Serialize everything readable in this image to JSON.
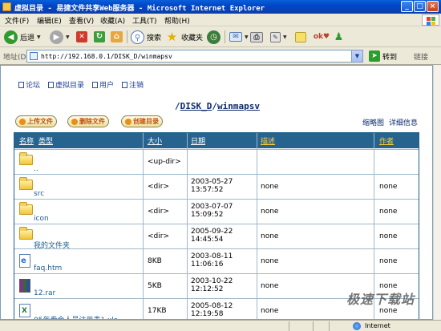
{
  "window": {
    "title": "虚拟目录 - 易捷文件共享Web服务器 - Microsoft Internet Explorer",
    "minimize": "_",
    "maximize": "□",
    "close": "×"
  },
  "menu": [
    "文件(F)",
    "编辑(E)",
    "查看(V)",
    "收藏(A)",
    "工具(T)",
    "帮助(H)"
  ],
  "toolbar": {
    "back": "后退",
    "search": "搜索",
    "favorites": "收藏夹"
  },
  "address": {
    "label": "地址(D)",
    "url": "http://192.168.0.1/DISK_D/winmapsv",
    "go": "转到",
    "links": "链接"
  },
  "nav": [
    "论坛",
    "虚拟目录",
    "用户",
    "注销"
  ],
  "path": {
    "slash1": "/",
    "disk": "DISK_D",
    "slash2": "/",
    "folder": "winmapsv"
  },
  "actions": {
    "upload": "上传文件",
    "delete": "删除文件",
    "mkdir": "创建目录",
    "thumbnails": "缩略图",
    "details": "详细信息"
  },
  "table": {
    "headers": {
      "name": "名称",
      "type": "类型",
      "size": "大小",
      "date": "日期",
      "desc": "描述",
      "author": "作者"
    },
    "rows": [
      {
        "icon": "folder",
        "name": "..",
        "size": "<up-dir>",
        "date1": "",
        "date2": "",
        "desc": "",
        "author": ""
      },
      {
        "icon": "folder",
        "name": "src",
        "size": "<dir>",
        "date1": "2003-05-27",
        "date2": "13:57:52",
        "desc": "none",
        "author": "none"
      },
      {
        "icon": "folder",
        "name": "icon",
        "size": "<dir>",
        "date1": "2003-07-07",
        "date2": "15:09:52",
        "desc": "none",
        "author": "none"
      },
      {
        "icon": "folder",
        "name": "我的文件夹",
        "size": "<dir>",
        "date1": "2005-09-22",
        "date2": "14:45:54",
        "desc": "none",
        "author": "none"
      },
      {
        "icon": "htm",
        "name": "faq.htm",
        "size": "8KB",
        "date1": "2003-08-11",
        "date2": "11:06:16",
        "desc": "none",
        "author": "none"
      },
      {
        "icon": "rar",
        "name": "12.rar",
        "size": "5KB",
        "date1": "2003-10-22",
        "date2": "12:12:52",
        "desc": "none",
        "author": "none"
      },
      {
        "icon": "xls",
        "name": "05年参会人员注册表1.xls",
        "size": "17KB",
        "date1": "2005-08-12",
        "date2": "12:19:58",
        "desc": "none",
        "author": "none"
      }
    ]
  },
  "status": {
    "zone": "Internet"
  },
  "watermark": "极速下载站"
}
